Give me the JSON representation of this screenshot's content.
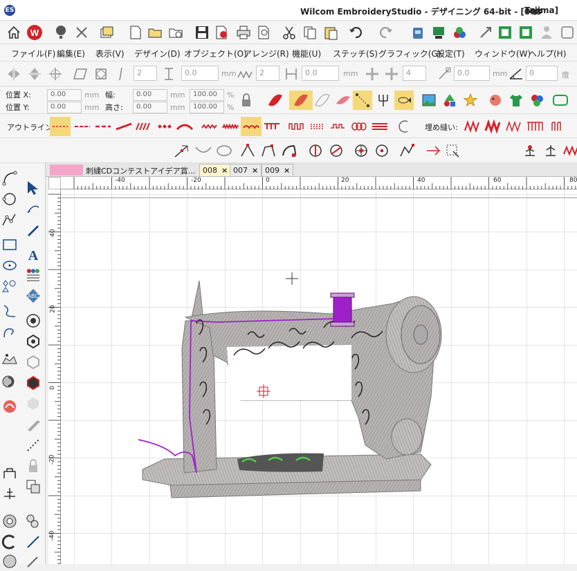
{
  "titlebar": {
    "title": "Wilcom EmbroideryStudio - デザイニング 64-bit - [008",
    "machine": "Tajima]"
  },
  "menu": [
    {
      "label": "ファイル(F)",
      "name": "menu-file"
    },
    {
      "label": "編集(E)",
      "name": "menu-edit"
    },
    {
      "label": "表示(V)",
      "name": "menu-view"
    },
    {
      "label": "デザイン(D)",
      "name": "menu-design"
    },
    {
      "label": "オブジェクト(O)",
      "name": "menu-object"
    },
    {
      "label": "アレンジ(R)",
      "name": "menu-arrange"
    },
    {
      "label": "機能(U)",
      "name": "menu-functions"
    },
    {
      "label": "ステッチ(S)",
      "name": "menu-stitch"
    },
    {
      "label": "グラフィック(G)",
      "name": "menu-graphics"
    },
    {
      "label": "設定(T)",
      "name": "menu-settings"
    },
    {
      "label": "ウィンドウ(W)",
      "name": "menu-window"
    },
    {
      "label": "ヘルプ(H)",
      "name": "menu-help"
    }
  ],
  "toolbar2": {
    "spin1": "2",
    "spin2": "0.0",
    "unit_mm": "mm",
    "spin3": "2",
    "spin4": "0.0",
    "spin5": "4",
    "spin6": "0.0",
    "spin7": "0",
    "unit_deg": "度"
  },
  "transform": {
    "pos_x_label": "位置 X:",
    "pos_y_label": "位置 Y:",
    "pos_x": "0.00",
    "pos_y": "0.00",
    "width_label": "幅:",
    "height_label": "高さ:",
    "width": "0.00",
    "height": "0.00",
    "scale_w": "100.00",
    "scale_h": "100.00",
    "unit_mm": "mm",
    "unit_pct": "%"
  },
  "toolbar4": {
    "outline_label": "アウトライン:",
    "fill_label": "埋め縫い:"
  },
  "tabs": [
    {
      "label": "刺繍CDコンテストアイデア賞...",
      "close": "×",
      "active": false
    },
    {
      "label": "008",
      "close": "×",
      "active": true
    },
    {
      "label": "007",
      "close": "×",
      "active": false
    },
    {
      "label": "009",
      "close": "×",
      "active": false
    }
  ],
  "ruler": {
    "top_labels": [
      "-40",
      "-20",
      "0",
      "20",
      "40",
      "60",
      "80"
    ],
    "left_labels": [
      "40",
      "20",
      "0",
      "-20",
      "-40"
    ]
  },
  "colors": {
    "accent_red": "#d2232a",
    "thread_purple": "#a020c8",
    "fabric_gray": "#9a9a9a"
  }
}
